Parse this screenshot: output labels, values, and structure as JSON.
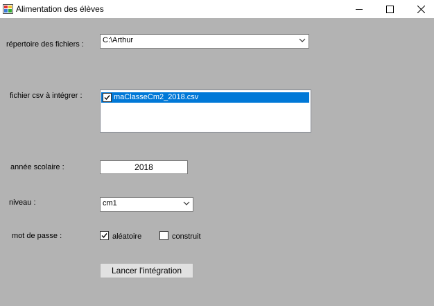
{
  "window": {
    "title": "Alimentation des élèves"
  },
  "form": {
    "directory_label": "répertoire des fichiers :",
    "directory_value": "C:\\Arthur",
    "csv_label": "fichier csv à intégrer :",
    "csv_files": [
      {
        "name": "maClasseCm2_2018.csv",
        "checked": true,
        "selected": true
      }
    ],
    "year_label": "année scolaire :",
    "year_value": "2018",
    "level_label": "niveau :",
    "level_value": "cm1",
    "password_label": "mot de passe :",
    "password_options": [
      {
        "label": "aléatoire",
        "checked": true
      },
      {
        "label": "construit",
        "checked": false
      }
    ],
    "submit_label": "Lancer l'intégration"
  },
  "icons": {
    "app": "app-icon",
    "minimize": "minimize-icon",
    "maximize": "maximize-icon",
    "close": "close-icon",
    "dropdown": "chevron-down-icon",
    "check": "checkmark-icon"
  },
  "colors": {
    "form_background": "#b3b3b3",
    "selection": "#0078d7"
  }
}
